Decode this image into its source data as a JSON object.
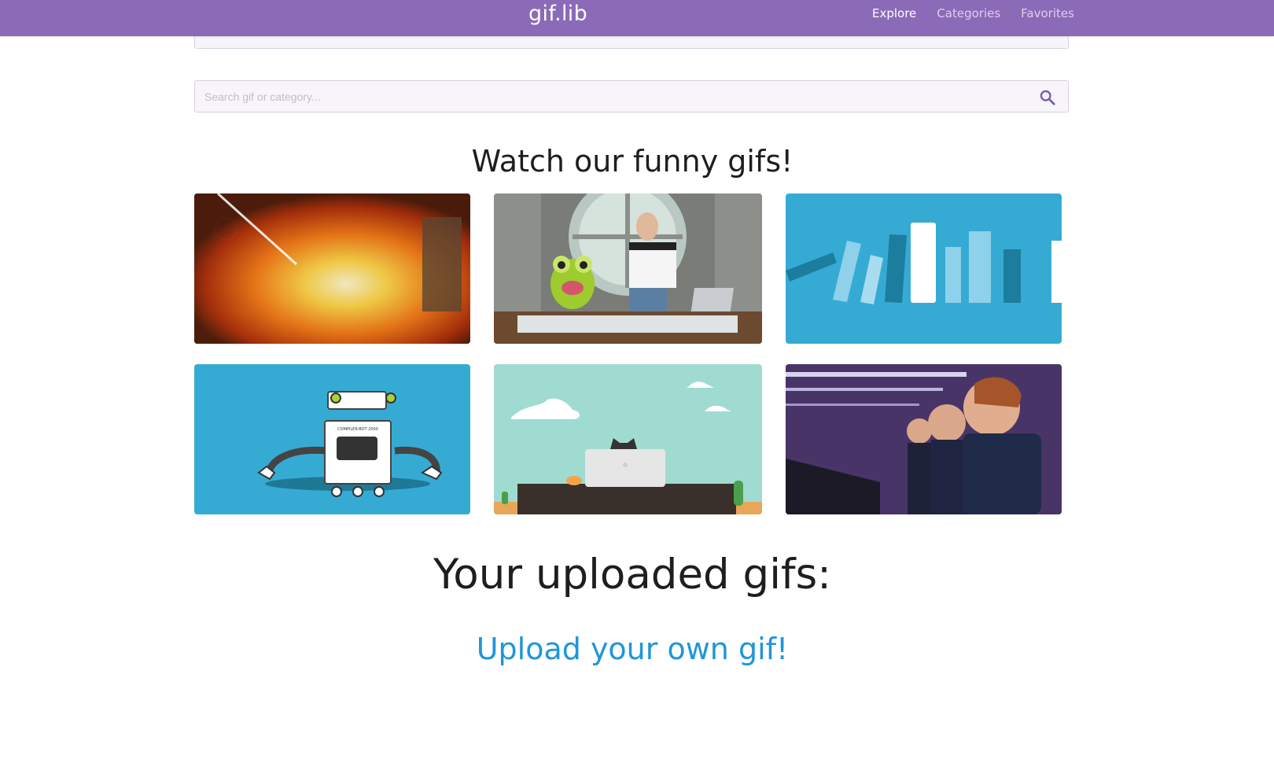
{
  "app": {
    "brand": "gif.lib",
    "nav": [
      {
        "label": "Explore",
        "active": true
      },
      {
        "label": "Categories",
        "active": false
      },
      {
        "label": "Favorites",
        "active": false
      }
    ]
  },
  "search": {
    "placeholder": "Search gif or category...",
    "value": ""
  },
  "main": {
    "heading": "Watch our funny gifs!",
    "gifs": [
      {
        "name": "explosion-gif"
      },
      {
        "name": "host-with-frog-gif"
      },
      {
        "name": "falling-books-gif"
      },
      {
        "name": "compiler-bot-gif",
        "caption": "COMPILER-BOT 2000"
      },
      {
        "name": "cat-laptop-gif"
      },
      {
        "name": "infinite-mirror-gif"
      }
    ]
  },
  "uploads": {
    "heading": "Your uploaded gifs:",
    "upload_link": "Upload your own gif!"
  },
  "colors": {
    "navbar": "#8b6ab8",
    "search_icon": "#7b5db5",
    "link": "#1f96d9",
    "tile_blue": "#35abd4",
    "tile_mint": "#a0dbd1"
  }
}
